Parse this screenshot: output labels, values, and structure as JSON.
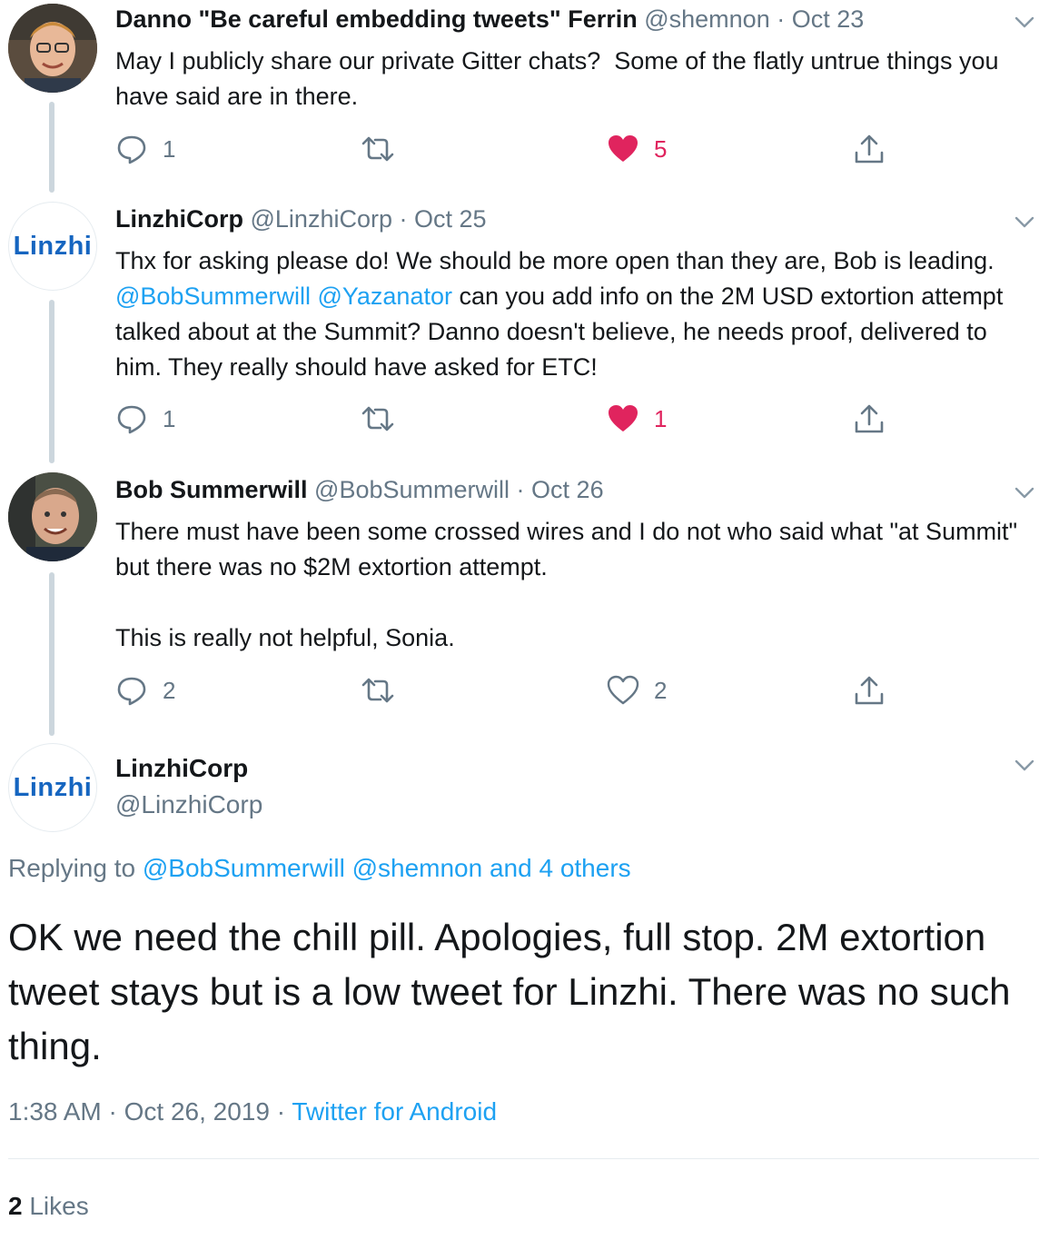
{
  "tweets": [
    {
      "name": "Danno \"Be careful embedding tweets\" Ferrin",
      "handle": "@shemnon",
      "date": "Oct 23",
      "sep": "·",
      "text": "May I publicly share our private Gitter chats?  Some of the flatly untrue things you have said are in there.",
      "reply_count": "1",
      "like_count": "5",
      "liked": true
    },
    {
      "name": "LinzhiCorp",
      "handle": "@LinzhiCorp",
      "date": "Oct 25",
      "sep": "·",
      "avatar_text": "Linzhi",
      "text_before": "Thx for asking please do! We should be more open than they are, Bob is leading. ",
      "mention1": "@BobSummerwill",
      "mention2": "@Yazanator",
      "text_after": " can you add info on the 2M USD extortion attempt talked about at the Summit? Danno doesn't believe, he needs proof, delivered to him. They really should have asked for ETC!",
      "reply_count": "1",
      "like_count": "1",
      "liked": true
    },
    {
      "name": "Bob Summerwill",
      "handle": "@BobSummerwill",
      "date": "Oct 26",
      "sep": "·",
      "text": "There must have been some crossed wires and I do not who said what \"at Summit\" but there was no $2M extortion attempt.\n\nThis is really not helpful, Sonia.",
      "reply_count": "2",
      "like_count": "2",
      "liked": false
    }
  ],
  "main": {
    "name": "LinzhiCorp",
    "handle": "@LinzhiCorp",
    "avatar_text": "Linzhi",
    "replying_label": "Replying to",
    "replying_mentions": "@BobSummerwill @shemnon",
    "replying_others": "and 4 others",
    "text": "OK we need the chill pill. Apologies, full stop. 2M extortion tweet stays but is a low tweet for Linzhi. There was no such thing.",
    "time": "1:38 AM",
    "date": "Oct 26, 2019",
    "sep": "·",
    "source": "Twitter for Android",
    "likes_count": "2",
    "likes_label": "Likes"
  },
  "colors": {
    "link": "#1da1f2",
    "like": "#e0245e",
    "muted": "#657786",
    "brand": "#1565c0"
  }
}
